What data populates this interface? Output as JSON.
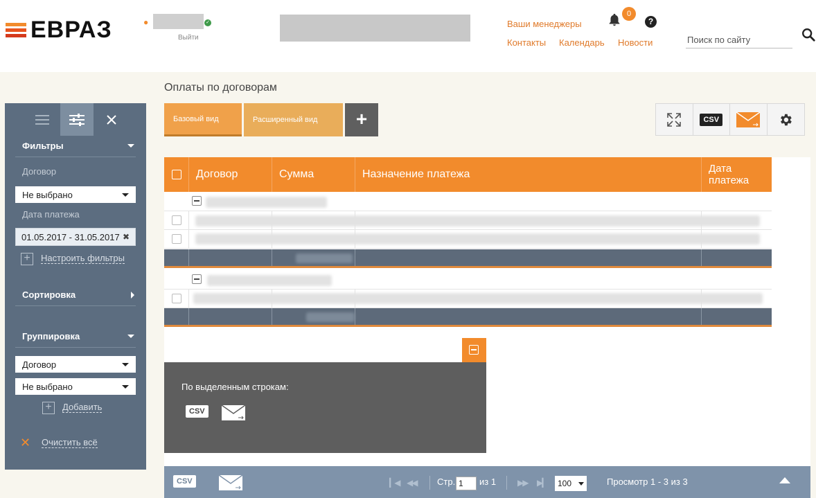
{
  "header": {
    "logo_text": "ЕВРАЗ",
    "logout_label": "Выйти",
    "links": {
      "managers": "Ваши менеджеры",
      "contacts": "Контакты",
      "calendar": "Календарь",
      "news": "Новости"
    },
    "notifications_count": "0",
    "help_label": "?",
    "search": {
      "placeholder": "Поиск по сайту"
    }
  },
  "page": {
    "title": "Оплаты по договорам"
  },
  "views": {
    "base_label": "Базовый вид",
    "extended_label": "Расширенный вид",
    "add_label": "+"
  },
  "tools": {
    "csv_label": "CSV"
  },
  "sidebar": {
    "filters": {
      "title": "Фильтры",
      "contract_label": "Договор",
      "contract_value": "Не выбрано",
      "date_label": "Дата платежа",
      "date_value": "01.05.2017 - 31.05.2017",
      "configure_label": "Настроить фильтры"
    },
    "sorting": {
      "title": "Сортировка"
    },
    "grouping": {
      "title": "Группировка",
      "first_value": "Договор",
      "second_value": "Не выбрано",
      "add_label": "Добавить"
    },
    "clear_label": "Очистить всё"
  },
  "table": {
    "columns": [
      "Договор",
      "Сумма",
      "Назначение платежа",
      "Дата\nплатежа"
    ]
  },
  "selected": {
    "title": "По выделенным строкам:",
    "csv_label": "CSV"
  },
  "footer": {
    "csv_label": "CSV",
    "page_label": "Стр.",
    "page_value": "1",
    "of_label": "из 1",
    "per_page": "100",
    "view_label": "Просмотр 1 - 3 из 3"
  },
  "colors": {
    "accent": "#f28b2c",
    "sidebar": "#5c6d80",
    "footer": "#7f93aa"
  }
}
